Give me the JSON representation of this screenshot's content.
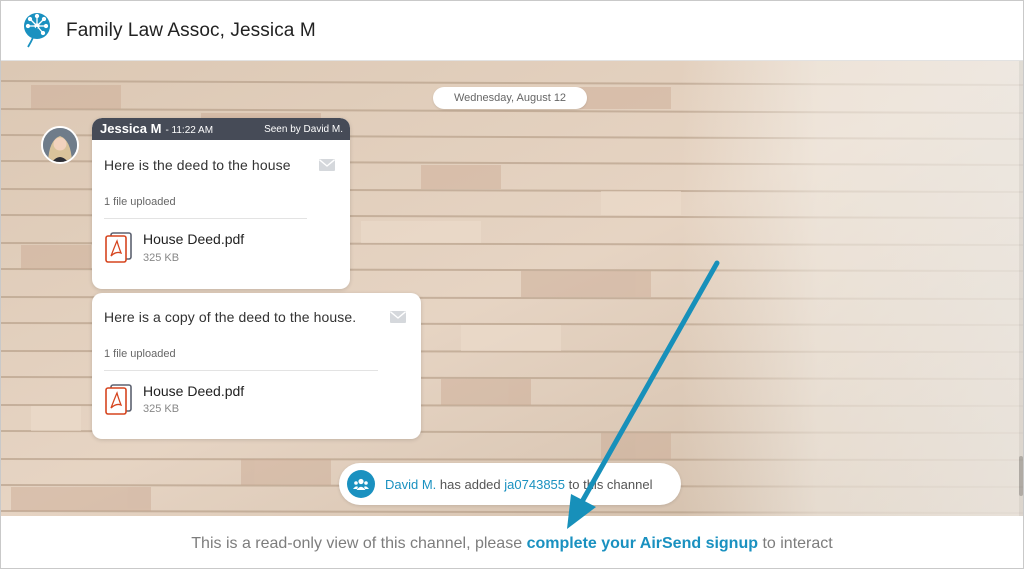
{
  "header": {
    "title": "Family Law Assoc, Jessica M",
    "logo_icon": "dandelion-logo-icon"
  },
  "colors": {
    "accent": "#1a91c0",
    "message_header": "#464b57",
    "pdf_red": "#d6451f"
  },
  "timeline": {
    "date_label": "Wednesday, August 12"
  },
  "messages": [
    {
      "author": "Jessica M",
      "time": "- 11:22 AM",
      "seen": "Seen by David M.",
      "text": "Here is the deed to the house",
      "files_count": "1 file uploaded",
      "file": {
        "name": "House Deed.pdf",
        "size": "325 KB"
      }
    },
    {
      "text": "Here is a copy of the deed to the house.",
      "files_count": "1 file uploaded",
      "file": {
        "name": "House Deed.pdf",
        "size": "325 KB"
      }
    }
  ],
  "event": {
    "actor": "David M.",
    "action": "has added",
    "target": "ja0743855",
    "suffix": "to this channel"
  },
  "footer": {
    "prefix": "This is a read-only view of this channel, please",
    "link": "complete your AirSend signup",
    "suffix": "to interact"
  }
}
